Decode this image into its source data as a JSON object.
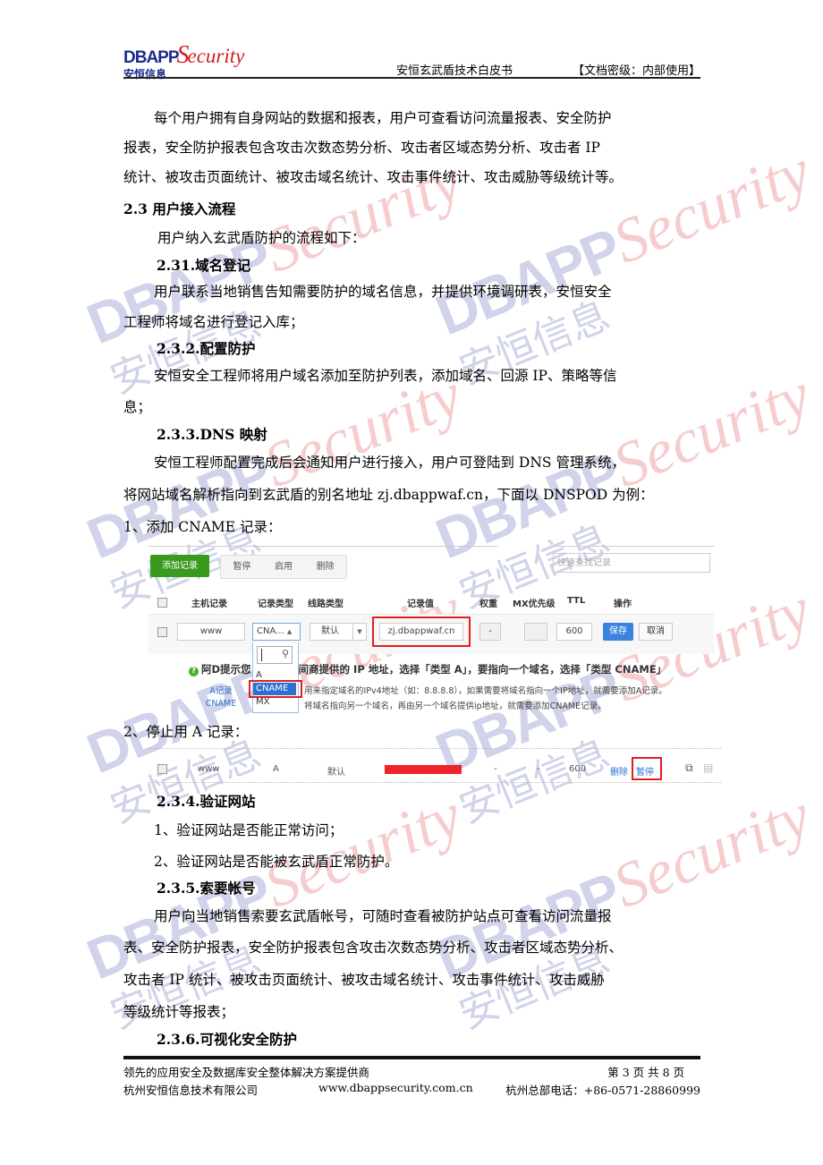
{
  "header": {
    "logo": {
      "brand_en": "DBAPP",
      "brand_script": "ecurity",
      "brand_cn": "安恒信息"
    },
    "doc_title": "安恒玄武盾技术白皮书",
    "classification": "【文档密级：内部使用】"
  },
  "body": {
    "intro": [
      "每个用户拥有自身网站的数据和报表，用户可查看访问流量报表、安全防护",
      "报表，安全防护报表包含攻击次数态势分析、攻击者区域态势分析、攻击者 IP",
      "统计、被攻击页面统计、被攻击域名统计、攻击事件统计、攻击威胁等级统计等。"
    ],
    "section_2_3": {
      "heading": "2.3 用户接入流程",
      "lead": "用户纳入玄武盾防护的流程如下：",
      "s1": {
        "heading": "2.31.域名登记",
        "lines": [
          "用户联系当地销售告知需要防护的域名信息，并提供环境调研表，安恒安全",
          "工程师将域名进行登记入库；"
        ]
      },
      "s2": {
        "heading": "2.3.2.配置防护",
        "lines": [
          "安恒安全工程师将用户域名添加至防护列表，添加域名、回源 IP、策略等信",
          "息；"
        ]
      },
      "s3": {
        "heading": "2.3.3.DNS 映射",
        "lines": [
          "安恒工程师配置完成后会通知用户进行接入，用户可登陆到 DNS 管理系统，",
          "将网站域名解析指向到玄武盾的别名地址 zj.dbappwaf.cn，下面以 DNSPOD 为例："
        ],
        "step1": "1、添加 CNAME 记录：",
        "step2": "2、停止用 A 记录："
      },
      "s4": {
        "heading": "2.3.4.验证网站",
        "items": [
          "1、验证网站是否能正常访问；",
          "2、验证网站是否能被玄武盾正常防护。"
        ]
      },
      "s5": {
        "heading": "2.3.5.索要帐号",
        "lines": [
          "用户向当地销售索要玄武盾帐号，可随时查看被防护站点可查看访问流量报",
          "表、安全防护报表，安全防护报表包含攻击次数态势分析、攻击者区域态势分析、",
          "攻击者 IP 统计、被攻击页面统计、被攻击域名统计、攻击事件统计、攻击威胁",
          "等级统计等报表；"
        ]
      },
      "s6": {
        "heading": "2.3.6.可视化安全防护"
      }
    }
  },
  "dns_screenshot": {
    "toolbar": {
      "add": "添加记录",
      "pause": "暂停",
      "enable": "启用",
      "delete": "删除",
      "search_placeholder": "快速查找记录"
    },
    "columns": [
      "主机记录",
      "记录类型",
      "线路类型",
      "记录值",
      "权重",
      "MX优先级",
      "TTL",
      "操作"
    ],
    "edit_row": {
      "host": "www",
      "type": "CNA...",
      "line": "默认",
      "value": "zj.dbappwaf.cn",
      "weight": "-",
      "mx": "",
      "ttl": "600",
      "save": "保存",
      "cancel": "取消"
    },
    "type_options": [
      "A",
      "CNAME",
      "MX"
    ],
    "selected_option": "CNAME",
    "tip": {
      "title_left": "阿D提示您",
      "title_right": "间商提供的 IP 地址，选择「类型 A」，要指向一个域名，选择「类型 CNAME」",
      "rows": [
        {
          "label": "A记录",
          "text": "用来指定域名的IPv4地址（如：8.8.8.8），如果需要将域名指向一个IP地址，就需要添加A记录。"
        },
        {
          "label": "CNAME",
          "text": "将域名指向另一个域名，再由另一个域名提供ip地址，就需要添加CNAME记录。"
        }
      ]
    }
  },
  "dns_screenshot2": {
    "row": {
      "host": "www",
      "type": "A",
      "line": "默认",
      "weight": "-",
      "mx": "-",
      "ttl": "600",
      "delete": "删除",
      "pause": "暂停"
    }
  },
  "footer": {
    "tagline": "领先的应用安全及数据库安全整体解决方案提供商",
    "page": "第   3  页  共  8  页",
    "company": "杭州安恒信息技术有限公司",
    "website": "www.dbappsecurity.com.cn",
    "phone": "杭州总部电话：+86-0571-28860999"
  },
  "colors": {
    "brand_blue": "#1c2a8a",
    "brand_red": "#d01d25",
    "add_green": "#3a9a1d",
    "save_blue": "#3a84e0",
    "highlight_red": "#e02020"
  }
}
